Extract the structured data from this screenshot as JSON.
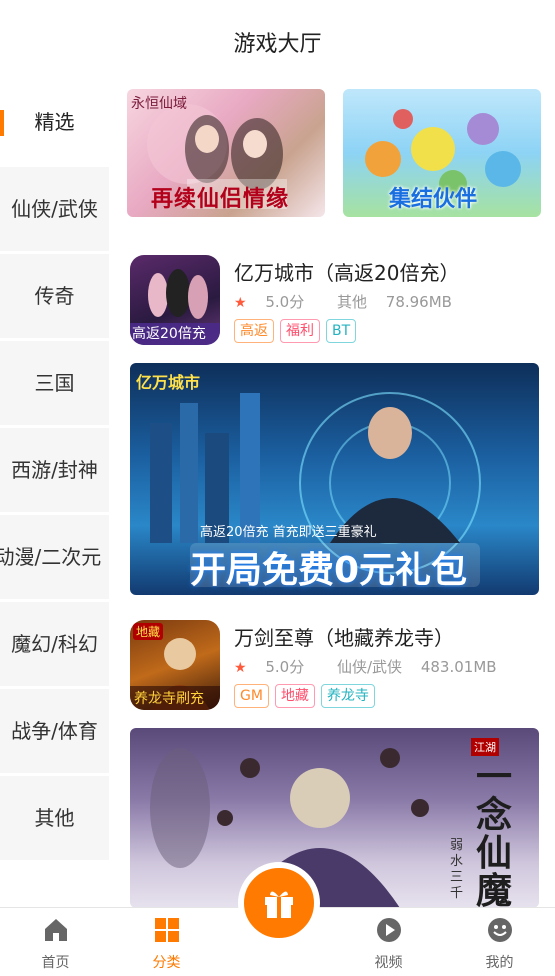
{
  "header": {
    "title": "游戏大厅"
  },
  "sidebar": {
    "items": [
      {
        "label": "精选",
        "active": true
      },
      {
        "label": "仙侠/武侠"
      },
      {
        "label": "传奇"
      },
      {
        "label": "三国"
      },
      {
        "label": "西游/封神"
      },
      {
        "label": "动漫/二次元"
      },
      {
        "label": "魔幻/科幻"
      },
      {
        "label": "战争/体育"
      },
      {
        "label": "其他"
      }
    ]
  },
  "banners": {
    "top_left": {
      "text": "再续仙侣情缘",
      "logo": "永恒仙域"
    },
    "top_right": {
      "text": "集结伙伴"
    }
  },
  "games": [
    {
      "title": "亿万城市（高返20倍充）",
      "rating": "5.0分",
      "category": "其他",
      "size": "78.96MB",
      "icon_text": "高返20倍充",
      "tags": [
        "高返",
        "福利",
        "BT"
      ],
      "banner": {
        "logo": "亿万城市",
        "subtitle": "高返20倍充  首充即送三重豪礼",
        "headline": "开局免费0元礼包"
      }
    },
    {
      "title": "万剑至尊（地藏养龙寺）",
      "rating": "5.0分",
      "category": "仙侠/武侠",
      "size": "483.01MB",
      "icon_text": "养龙寺刷充",
      "icon_badge": "地藏",
      "tags": [
        "GM",
        "地藏",
        "养龙寺"
      ],
      "banner": {
        "headline": "一念仙魔",
        "side_text": "弱水三千",
        "badge": "江湖"
      }
    }
  ],
  "tabbar": {
    "items": [
      {
        "label": "首页",
        "icon": "home-icon"
      },
      {
        "label": "分类",
        "icon": "grid-icon",
        "active": true
      },
      {
        "label": "",
        "icon": "gift-icon"
      },
      {
        "label": "视频",
        "icon": "play-icon"
      },
      {
        "label": "我的",
        "icon": "smile-icon"
      }
    ]
  },
  "colors": {
    "accent": "#ff7a00",
    "sidebar_bg": "#f6f6f6"
  }
}
